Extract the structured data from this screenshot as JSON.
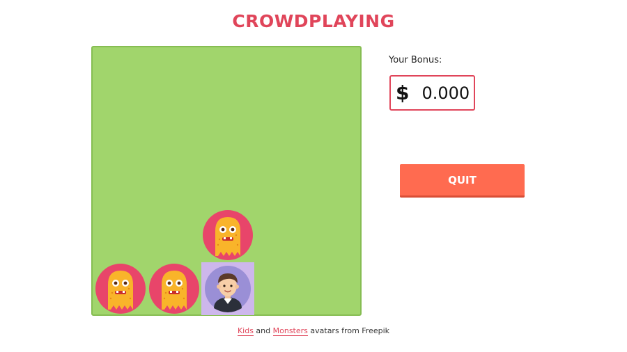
{
  "title": "CROWDPLAYING",
  "bonus": {
    "label": "Your Bonus:",
    "currency": "$",
    "value": "0.000"
  },
  "quit_label": "QUIT",
  "board": {
    "grid_size": 5,
    "tokens": [
      {
        "type": "monster",
        "row": 3,
        "col": 2
      },
      {
        "type": "monster",
        "row": 4,
        "col": 0
      },
      {
        "type": "monster",
        "row": 4,
        "col": 1
      },
      {
        "type": "kid",
        "row": 4,
        "col": 2,
        "self": true
      }
    ]
  },
  "credits": {
    "kids_link": "Kids",
    "and": "and",
    "monsters_link": "Monsters",
    "suffix": "avatars from Freepik"
  },
  "colors": {
    "accent": "#e0455a",
    "board": "#a1d56c",
    "quit": "#ff6b50",
    "self_cell": "#cdb7ec",
    "monster_bg": "#e8456a",
    "monster_body": "#f9b42a",
    "kid_bg": "#9a8fd6"
  }
}
